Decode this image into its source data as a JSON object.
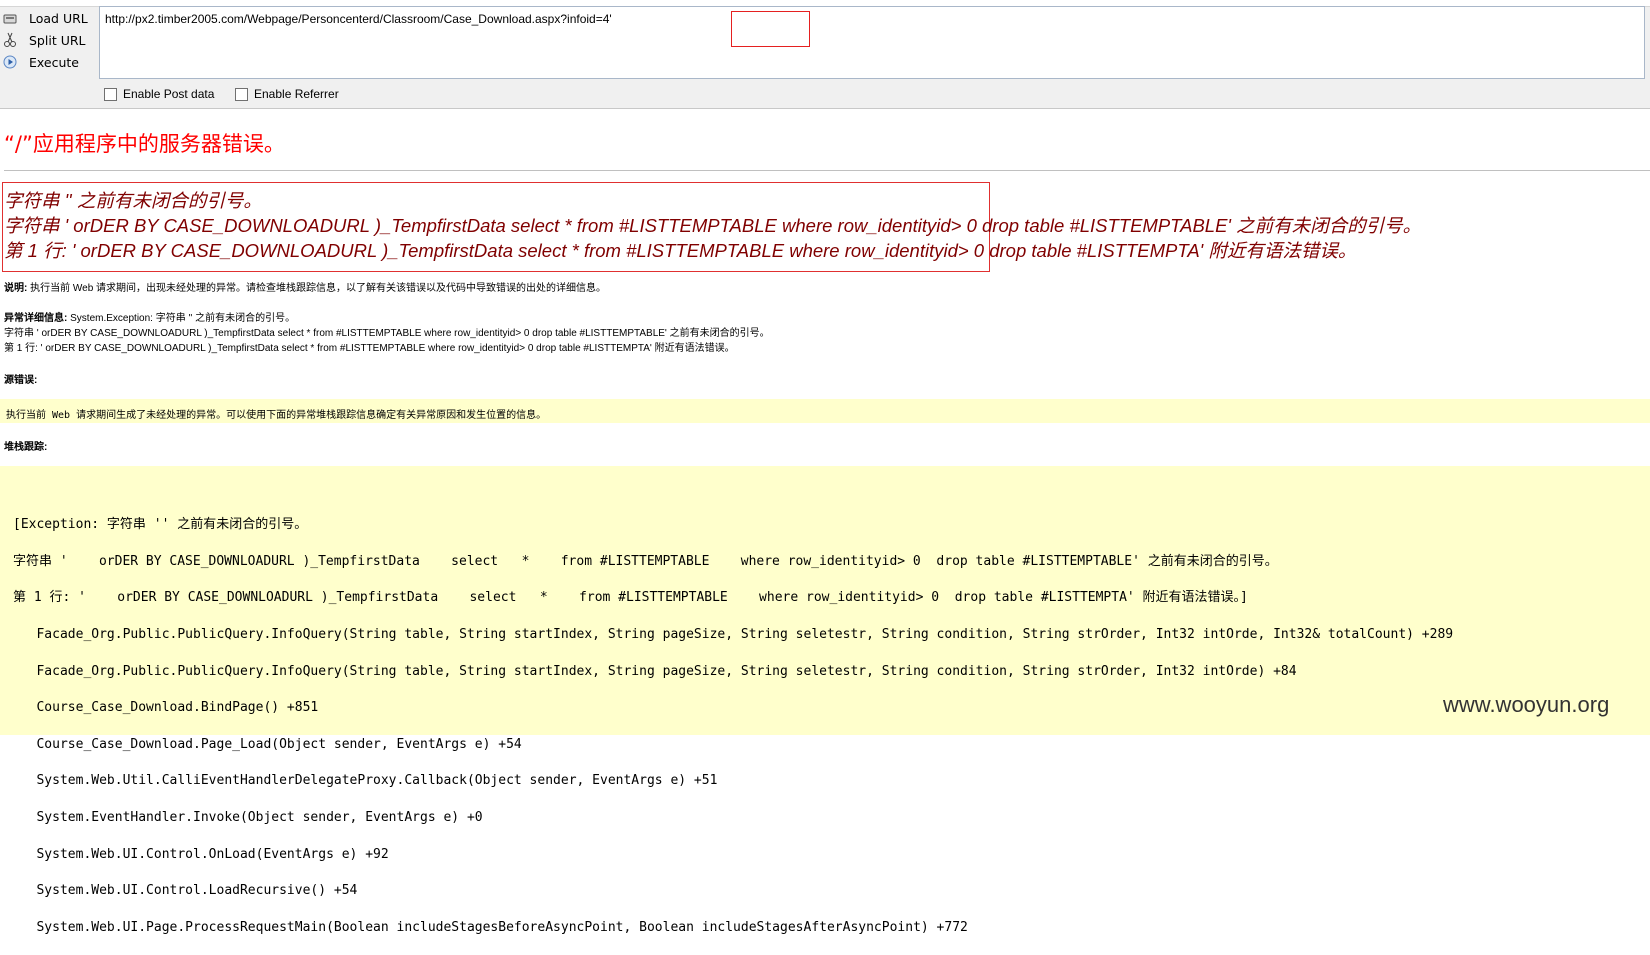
{
  "toolbar": {
    "buttons": [
      {
        "label": "Load URL",
        "icon": "load-url-icon"
      },
      {
        "label": "Split URL",
        "icon": "split-url-icon"
      },
      {
        "label": "Execute",
        "icon": "execute-icon"
      }
    ],
    "url": "http://px2.timber2005.com/Webpage/Personcenterd/Classroom/Case_Download.aspx?infoid=4'",
    "enable_post": "Enable Post data",
    "enable_referrer": "Enable Referrer"
  },
  "error_page": {
    "title": "“/”应用程序中的服务器错误。",
    "messages": [
      "字符串 '' 之前有未闭合的引号。",
      "字符串 '    orDER BY CASE_DOWNLOADURL )_TempfirstData    select   *    from #LISTTEMPTABLE    where row_identityid> 0  drop table #LISTTEMPTABLE' 之前有未闭合的引号。",
      "第 1 行: '    orDER BY CASE_DOWNLOADURL )_TempfirstData    select   *    from #LISTTEMPTABLE    where row_identityid> 0  drop table #LISTTEMPTA' 附近有语法错误。"
    ],
    "description_label": "说明:",
    "description": "执行当前 Web 请求期间，出现未经处理的异常。请检查堆栈跟踪信息，以了解有关该错误以及代码中导致错误的出处的详细信息。",
    "exception_label": "异常详细信息:",
    "exception_lines": [
      "System.Exception: 字符串 '' 之前有未闭合的引号。",
      "字符串 '    orDER BY CASE_DOWNLOADURL )_TempfirstData    select   *    from #LISTTEMPTABLE    where row_identityid> 0  drop table #LISTTEMPTABLE' 之前有未闭合的引号。",
      "第 1 行: '    orDER BY CASE_DOWNLOADURL )_TempfirstData    select   *    from #LISTTEMPTABLE    where row_identityid> 0  drop table #LISTTEMPTA' 附近有语法错误。"
    ],
    "source_error_label": "源错误:",
    "source_error_text": "执行当前 Web 请求期间生成了未经处理的异常。可以使用下面的异常堆栈跟踪信息确定有关异常原因和发生位置的信息。",
    "stack_trace_label": "堆栈跟踪:",
    "stack_trace": [
      "[Exception: 字符串 '' 之前有未闭合的引号。",
      "字符串 '    orDER BY CASE_DOWNLOADURL )_TempfirstData    select   *    from #LISTTEMPTABLE    where row_identityid> 0  drop table #LISTTEMPTABLE' 之前有未闭合的引号。",
      "第 1 行: '    orDER BY CASE_DOWNLOADURL )_TempfirstData    select   *    from #LISTTEMPTABLE    where row_identityid> 0  drop table #LISTTEMPTA' 附近有语法错误。]",
      "   Facade_Org.Public.PublicQuery.InfoQuery(String table, String startIndex, String pageSize, String seletestr, String condition, String strOrder, Int32 intOrde, Int32& totalCount) +289",
      "   Facade_Org.Public.PublicQuery.InfoQuery(String table, String startIndex, String pageSize, String seletestr, String condition, String strOrder, Int32 intOrde) +84",
      "   Course_Case_Download.BindPage() +851",
      "   Course_Case_Download.Page_Load(Object sender, EventArgs e) +54",
      "   System.Web.Util.CalliEventHandlerDelegateProxy.Callback(Object sender, EventArgs e) +51",
      "   System.EventHandler.Invoke(Object sender, EventArgs e) +0",
      "   System.Web.UI.Control.OnLoad(EventArgs e) +92",
      "   System.Web.UI.Control.LoadRecursive() +54",
      "   System.Web.UI.Page.ProcessRequestMain(Boolean includeStagesBeforeAsyncPoint, Boolean includeStagesAfterAsyncPoint) +772"
    ]
  },
  "watermark": "www.wooyun.org",
  "colors": {
    "title_red": "#ff0000",
    "message_maroon": "#800000",
    "yellow_band": "#ffffcc",
    "highlight_red": "#e52020"
  }
}
